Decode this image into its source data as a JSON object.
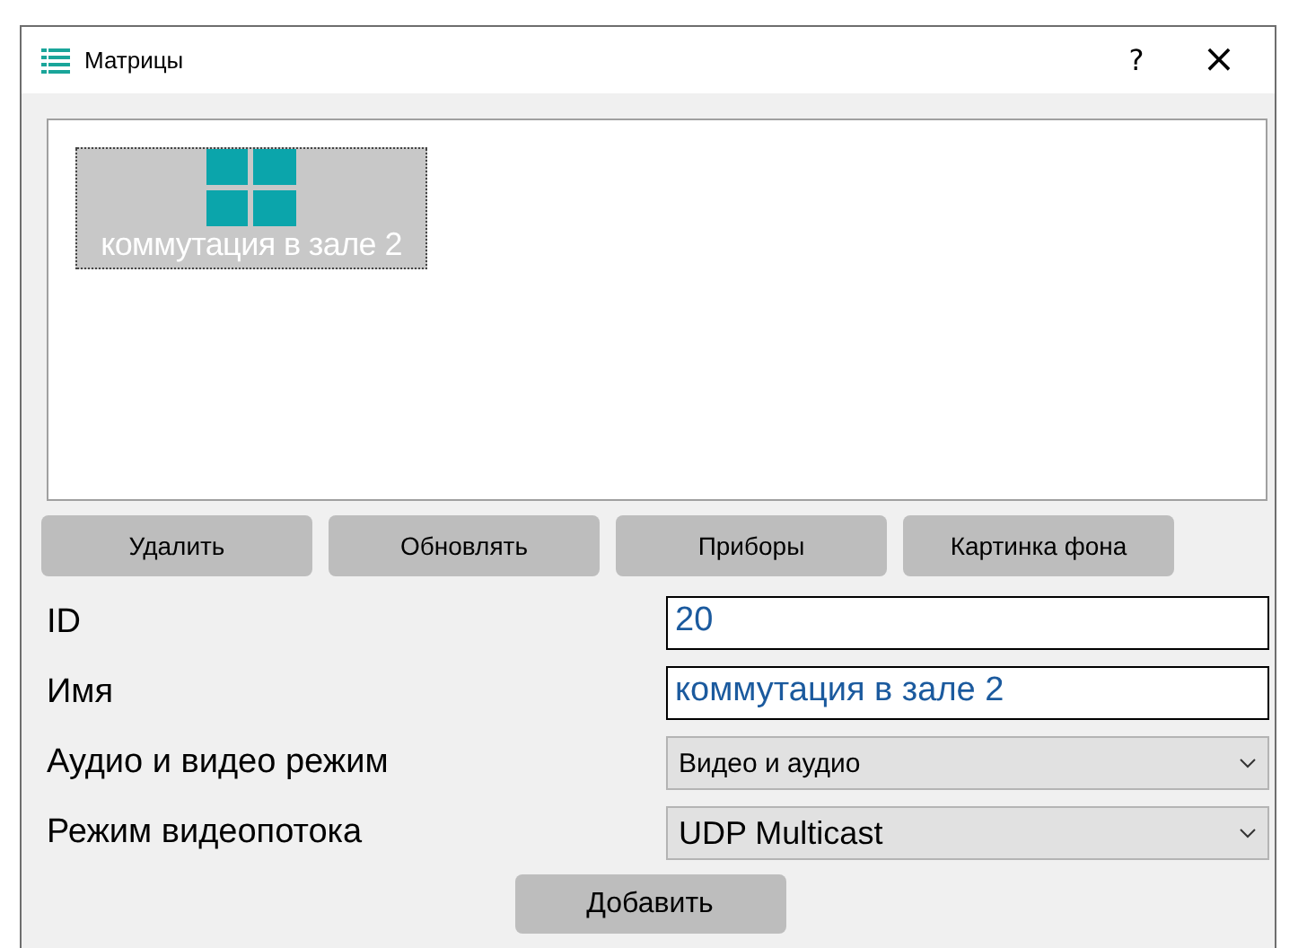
{
  "window": {
    "title": "Матрицы",
    "help": "?",
    "close": "×"
  },
  "matrices": [
    {
      "name": "коммутация в зале 2",
      "selected": true
    }
  ],
  "buttons": [
    "Удалить",
    "Обновлять",
    "Приборы",
    "Картинка фона"
  ],
  "fields": [
    {
      "kind": "text",
      "label": "ID",
      "value": "20"
    },
    {
      "kind": "text",
      "label": "Имя",
      "value": "коммутация в зале 2"
    },
    {
      "kind": "combo",
      "label": "Аудио и видео режим",
      "value": "Видео и аудио"
    },
    {
      "kind": "combo",
      "label": "Режим видеопотока",
      "value": "UDP Multicast"
    }
  ],
  "add_button": "Добавить"
}
